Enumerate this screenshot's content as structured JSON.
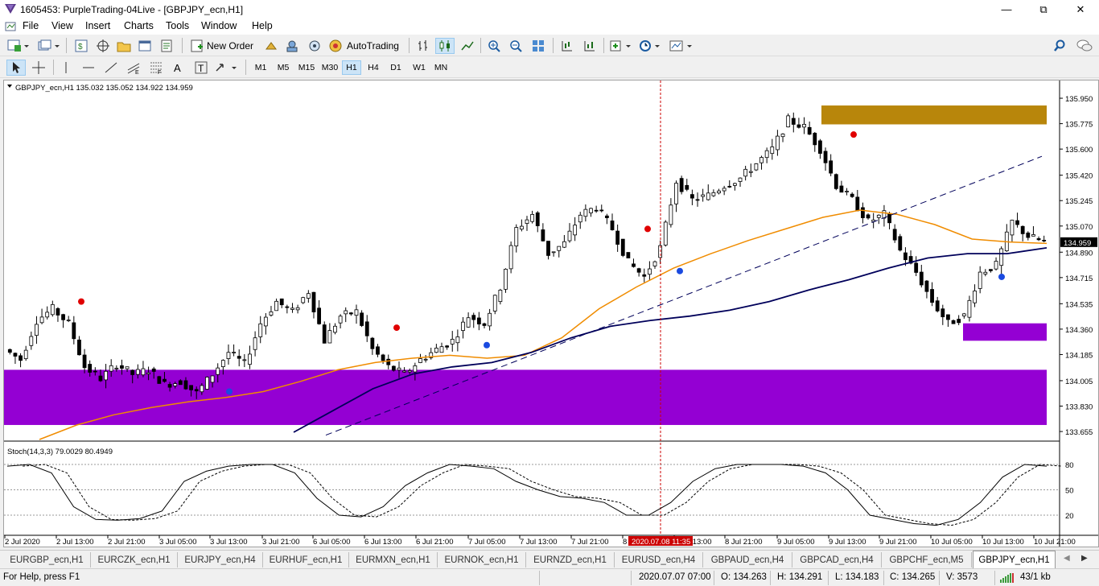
{
  "window": {
    "title": "1605453: PurpleTrading-04Live - [GBPJPY_ecn,H1]"
  },
  "menu": [
    "File",
    "View",
    "Insert",
    "Charts",
    "Tools",
    "Window",
    "Help"
  ],
  "toolbar": {
    "new_order": "New Order",
    "autotrading": "AutoTrading"
  },
  "timeframes": [
    "M1",
    "M5",
    "M15",
    "M30",
    "H1",
    "H4",
    "D1",
    "W1",
    "MN"
  ],
  "active_timeframe": "H1",
  "chart": {
    "header": "GBPJPY_ecn,H1  135.032 135.052 134.922 134.959",
    "current_price": "134.959",
    "crosshair_time": "2020.07.08 11:35",
    "stoch_label": "Stoch(14,3,3) 79.0029 80.4949"
  },
  "chart_data": {
    "type": "candlestick",
    "symbol": "GBPJPY_ecn",
    "timeframe": "H1",
    "ylim": [
      133.6,
      136.05
    ],
    "price_ticks": [
      "135.950",
      "135.775",
      "135.600",
      "135.420",
      "135.245",
      "135.070",
      "134.890",
      "134.715",
      "134.535",
      "134.360",
      "134.185",
      "134.005",
      "133.830",
      "133.655"
    ],
    "time_ticks": [
      "2 Jul 2020",
      "2 Jul 13:00",
      "2 Jul 21:00",
      "3 Jul 05:00",
      "3 Jul 13:00",
      "3 Jul 21:00",
      "6 Jul 05:00",
      "6 Jul 13:00",
      "6 Jul 21:00",
      "7 Jul 05:00",
      "7 Jul 13:00",
      "7 Jul 21:00",
      "8",
      "8 Jul 13:00",
      "8 Jul 21:00",
      "9 Jul 05:00",
      "9 Jul 13:00",
      "9 Jul 21:00",
      "10 Jul 05:00",
      "10 Jul 13:00",
      "10 Jul 21:00"
    ],
    "stoch_levels": [
      80,
      50,
      20
    ],
    "stoch_ylim": [
      0,
      100
    ],
    "close_path": [
      134.22,
      134.15,
      134.42,
      134.5,
      134.4,
      134.1,
      134.02,
      134.12,
      134.05,
      134.08,
      133.98,
      134.0,
      133.92,
      134.05,
      134.2,
      134.12,
      134.4,
      134.55,
      134.48,
      134.62,
      134.28,
      134.45,
      134.48,
      134.22,
      134.1,
      134.05,
      134.15,
      134.22,
      134.28,
      134.45,
      134.4,
      134.65,
      135.05,
      135.15,
      134.88,
      134.95,
      135.15,
      135.2,
      135.05,
      134.82,
      134.72,
      134.92,
      135.38,
      135.25,
      135.28,
      135.35,
      135.4,
      135.5,
      135.6,
      135.8,
      135.75,
      135.6,
      135.35,
      135.25,
      135.1,
      135.15,
      134.9,
      134.75,
      134.55,
      134.4,
      134.45,
      134.75,
      134.8,
      135.1,
      135.0,
      134.96
    ],
    "ma_orange": [
      133.6,
      133.7,
      133.77,
      133.82,
      133.86,
      133.89,
      133.93,
      134.0,
      134.08,
      134.13,
      134.16,
      134.18,
      134.16,
      134.18,
      134.3,
      134.5,
      134.65,
      134.78,
      134.88,
      134.97,
      135.05,
      135.13,
      135.18,
      135.15,
      135.08,
      134.98,
      134.96,
      134.95
    ],
    "ma_navy": [
      133.65,
      133.8,
      133.95,
      134.05,
      134.1,
      134.13,
      134.2,
      134.3,
      134.38,
      134.42,
      134.45,
      134.49,
      134.55,
      134.63,
      134.7,
      134.78,
      134.85,
      134.88,
      134.88,
      134.92
    ],
    "zones": [
      {
        "name": "supply-zone",
        "color": "#b8860b",
        "price_top": 135.9,
        "price_bottom": 135.77
      },
      {
        "name": "demand-zone-upper",
        "color": "#9400d3",
        "price_top": 134.4,
        "price_bottom": 134.28
      },
      {
        "name": "demand-zone-lower",
        "color": "#9400d3",
        "price_top": 134.08,
        "price_bottom": 133.7
      }
    ]
  },
  "tabs": [
    "EURGBP_ecn,H1",
    "EURCZK_ecn,H1",
    "EURJPY_ecn,H4",
    "EURHUF_ecn,H1",
    "EURMXN_ecn,H1",
    "EURNOK_ecn,H1",
    "EURNZD_ecn,H1",
    "EURUSD_ecn,H4",
    "GBPAUD_ecn,H4",
    "GBPCAD_ecn,H4",
    "GBPCHF_ecn,M5",
    "GBPJPY_ecn,H1"
  ],
  "active_tab": "GBPJPY_ecn,H1",
  "status": {
    "help": "For Help, press F1",
    "datetime": "2020.07.07 07:00",
    "open": "O: 134.263",
    "high": "H: 134.291",
    "low": "L: 134.183",
    "close": "C: 134.265",
    "volume": "V: 3573",
    "traffic": "43/1 kb"
  },
  "colors": {
    "bull": "#ffffff",
    "bear": "#000000",
    "ma_fast": "#f08c00",
    "ma_slow": "#00005a",
    "crosshair": "#cc0000",
    "price_tag": "#000000"
  }
}
